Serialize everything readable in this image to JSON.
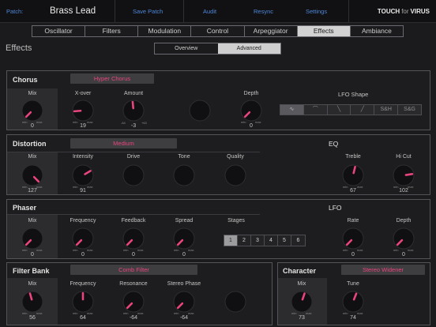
{
  "topbar": {
    "patch_label": "Patch:",
    "patch_name": "Brass Lead",
    "save": "Save Patch",
    "audit": "Audit",
    "resync": "Resync",
    "settings": "Settings",
    "brand_touch": "TOUCH",
    "brand_for": "for",
    "brand_virus": "VIRUS"
  },
  "tabs": [
    "Oscillator",
    "Filters",
    "Modulation",
    "Control",
    "Arpeggiator",
    "Effects",
    "Ambiance"
  ],
  "active_tab": "Effects",
  "page_title": "Effects",
  "view": {
    "overview": "Overview",
    "advanced": "Advanced",
    "active": "Advanced"
  },
  "scale": {
    "min": "min",
    "max": "max"
  },
  "chorus": {
    "title": "Chorus",
    "type": "Hyper Chorus",
    "knobs": [
      {
        "label": "Mix",
        "value": "0",
        "level": 0.0
      },
      {
        "label": "X-over",
        "value": "19",
        "level": 0.15
      },
      {
        "label": "Amount",
        "value": "-3",
        "level": 0.48,
        "bipolar_min": "-64",
        "bipolar_max": "+63"
      },
      {
        "label": "",
        "value": "",
        "level": 0.5
      },
      {
        "label": "Depth",
        "value": "0",
        "level": 0.0
      }
    ],
    "lfo_shape_label": "LFO Shape",
    "lfo_shapes": [
      "∿",
      "⌒",
      "╲",
      "╱",
      "S&H",
      "S&G"
    ]
  },
  "distortion": {
    "title": "Distortion",
    "type": "Medium",
    "knobs": [
      {
        "label": "Mix",
        "value": "127",
        "level": 1.0
      },
      {
        "label": "Intensity",
        "value": "91",
        "level": 0.72
      },
      {
        "label": "Drive",
        "value": "",
        "level": 0.5
      },
      {
        "label": "Tone",
        "value": "",
        "level": 0.5
      },
      {
        "label": "Quality",
        "value": "",
        "level": 0.5
      }
    ]
  },
  "eq": {
    "title": "EQ",
    "knobs": [
      {
        "label": "Treble",
        "value": "67",
        "level": 0.55
      },
      {
        "label": "Hi Cut",
        "value": "102",
        "level": 0.8
      }
    ]
  },
  "phaser": {
    "title": "Phaser",
    "knobs": [
      {
        "label": "Mix",
        "value": "0",
        "level": 0.0
      },
      {
        "label": "Frequency",
        "value": "0",
        "level": 0.0
      },
      {
        "label": "Feedback",
        "value": "0",
        "level": 0.0
      },
      {
        "label": "Spread",
        "value": "0",
        "level": 0.0
      }
    ],
    "stages_label": "Stages",
    "stages": [
      "1",
      "2",
      "3",
      "4",
      "5",
      "6"
    ],
    "active_stage": "1"
  },
  "lfo": {
    "title": "LFO",
    "knobs": [
      {
        "label": "Rate",
        "value": "0",
        "level": 0.0
      },
      {
        "label": "Depth",
        "value": "0",
        "level": 0.0
      }
    ]
  },
  "filterbank": {
    "title": "Filter Bank",
    "type": "Comb Filter",
    "knobs": [
      {
        "label": "Mix",
        "value": "56",
        "level": 0.44
      },
      {
        "label": "Frequency",
        "value": "64",
        "level": 0.5
      },
      {
        "label": "Resonance",
        "value": "-64",
        "level": 0.0
      },
      {
        "label": "Stereo Phase",
        "value": "-64",
        "level": 0.0
      },
      {
        "label": "",
        "value": "",
        "level": 0.5
      }
    ]
  },
  "character": {
    "title": "Character",
    "type": "Stereo Widener",
    "knobs": [
      {
        "label": "Mix",
        "value": "73",
        "level": 0.57
      },
      {
        "label": "Tune",
        "value": "74",
        "level": 0.58
      }
    ]
  },
  "colors": {
    "accent": "#e8457c",
    "link": "#4f86d8",
    "panel_bg": "#1d1d1f"
  }
}
